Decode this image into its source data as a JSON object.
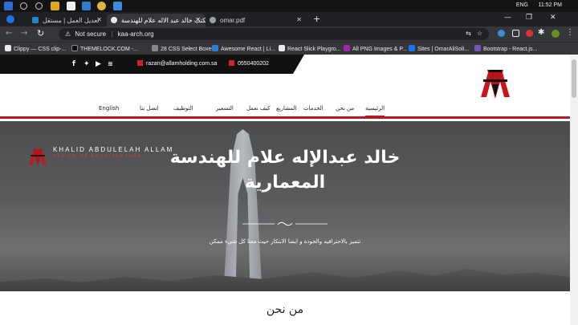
{
  "taskbar": {
    "lang": "ENG",
    "time": "11:52 PM"
  },
  "tabs": [
    {
      "label": "تعديل العمل | مستقل",
      "active": false
    },
    {
      "label": "مكتب خالد عبد الاله علام للهندسة",
      "active": true
    },
    {
      "label": "omar.pdf",
      "active": false
    }
  ],
  "addressbar": {
    "security": "Not secure",
    "url": "kaa-arch.org"
  },
  "bookmarks": [
    "Clippy — CSS clip-...",
    "THEMELOCK.COM -...",
    "28 CSS Select Boxes",
    "Awesome React | Li...",
    "React Slick Playgro...",
    "All PNG Images & P...",
    "Sites | OmarAliSoli...",
    "Bootstrap - React.js..."
  ],
  "site": {
    "email": "razan@allamholding.com.sa",
    "phone": "0550400202",
    "logo_text": "KAA",
    "nav": {
      "home": "الرئيسية",
      "about": "من نحن",
      "services": "الخدمات",
      "projects": "المشاريع",
      "how": "كيف نعمل",
      "pricing": "التسعير",
      "jobs": "التوظيف",
      "contact": "اتصل بنا",
      "english": "English"
    },
    "hero": {
      "brand_name": "KHALID ABDULELAH ALLAM",
      "brand_sub": "OFFICE OF ARCHITECTURE",
      "title": "خالد عبدالإله علام للهندسة المعمارية",
      "subtitle": "تتميز بالاحترافيه والجودة و ايضا الابتكار حيث معنا كل شيء ممكن"
    },
    "about_heading": "من نحن"
  },
  "colors": {
    "brand_red": "#b11a22",
    "topbar_black": "#111111",
    "browser_dark": "#202124"
  }
}
